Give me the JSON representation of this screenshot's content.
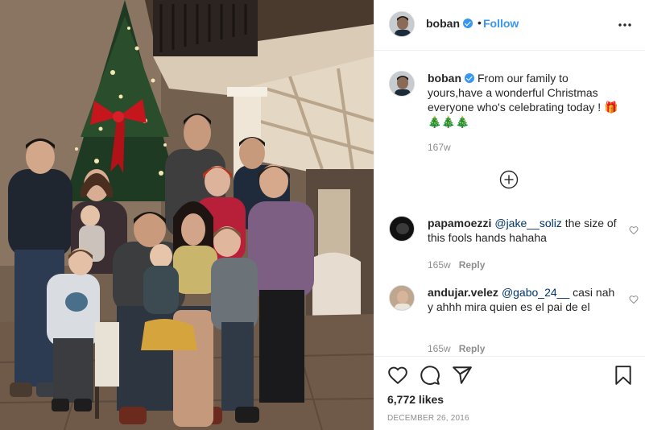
{
  "post": {
    "username": "boban",
    "verified": true,
    "follow_separator": "•",
    "follow_label": "Follow",
    "more_icon": "more-horizontal-icon"
  },
  "caption": {
    "username": "boban",
    "text": "From our family to yours,have a wonderful Christmas everyone who's celebrating today !",
    "emoji_gift": "🎁",
    "emoji_trees": "🎄🎄🎄",
    "age": "167w"
  },
  "comments": [
    {
      "username": "papamoezzi",
      "mention": "@jake__soliz",
      "text": " the size of this fools hands hahaha",
      "age": "165w",
      "reply_label": "Reply"
    },
    {
      "username": "andujar.velez",
      "mention": "@gabo_24__",
      "text": " casi nah y ahhh mira quien es el pai de el",
      "age": "165w",
      "reply_label": "Reply"
    }
  ],
  "load_more_icon": "plus-circle-icon",
  "actions": {
    "like_icon": "heart-icon",
    "comment_icon": "comment-icon",
    "share_icon": "share-icon",
    "save_icon": "bookmark-icon",
    "likes": "6,772 likes",
    "date": "DECEMBER 26, 2016"
  },
  "colors": {
    "link_blue": "#3897f0",
    "mention_blue": "#003569",
    "muted": "#8e8e8e",
    "text": "#262626",
    "divider": "#efefef"
  }
}
